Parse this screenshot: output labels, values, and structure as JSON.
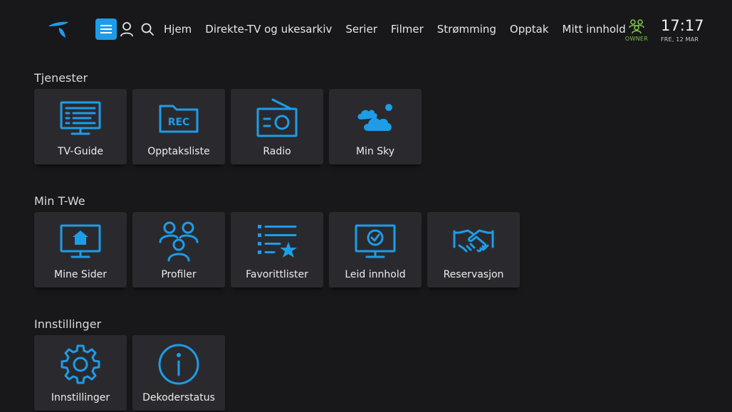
{
  "header": {
    "nav": [
      "Hjem",
      "Direkte-TV og ukesarkiv",
      "Serier",
      "Filmer",
      "Strømming",
      "Opptak",
      "Mitt innhold"
    ],
    "owner_label": "OWNER",
    "time": "17:17",
    "date": "FRE, 12 MAR"
  },
  "sections": [
    {
      "title": "Tjenester",
      "tiles": [
        {
          "label": "TV-Guide",
          "icon": "tv-guide-icon"
        },
        {
          "label": "Opptaksliste",
          "icon": "rec-folder-icon",
          "icon_text": "REC"
        },
        {
          "label": "Radio",
          "icon": "radio-icon"
        },
        {
          "label": "Min Sky",
          "icon": "cloud-icon"
        }
      ]
    },
    {
      "title": "Min T-We",
      "tiles": [
        {
          "label": "Mine Sider",
          "icon": "home-screen-icon"
        },
        {
          "label": "Profiler",
          "icon": "profiles-icon"
        },
        {
          "label": "Favorittlister",
          "icon": "favorite-list-icon"
        },
        {
          "label": "Leid innhold",
          "icon": "rented-check-icon"
        },
        {
          "label": "Reservasjon",
          "icon": "handshake-icon"
        }
      ]
    },
    {
      "title": "Innstillinger",
      "tiles": [
        {
          "label": "Innstillinger",
          "icon": "gear-icon"
        },
        {
          "label": "Dekoderstatus",
          "icon": "info-icon"
        }
      ]
    }
  ],
  "colors": {
    "accent": "#1e9ce8",
    "owner": "#7ec04a",
    "background": "#18181a",
    "tile": "#2a2a2e"
  }
}
